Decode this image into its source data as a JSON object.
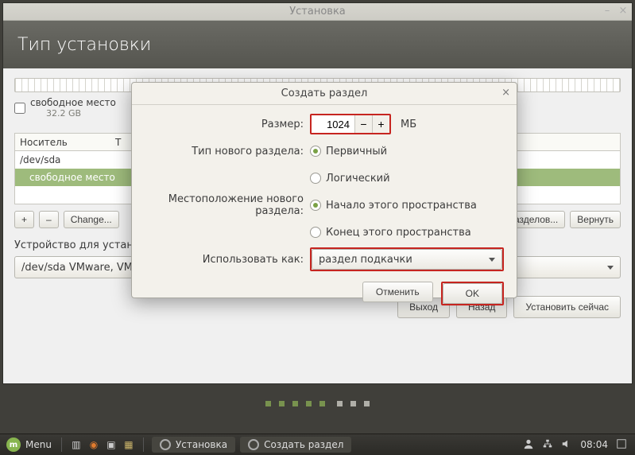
{
  "window": {
    "title": "Установка",
    "minimize": "–",
    "close": "×"
  },
  "header": {
    "title": "Тип установки"
  },
  "free_space": {
    "checkbox_label": "свободное место",
    "size": "32.2 GB"
  },
  "table": {
    "col_device": "Носитель",
    "col_type_initial": "Т",
    "row_device": "/dev/sda",
    "row_free": "свободное место"
  },
  "toolbar": {
    "plus": "+",
    "minus": "–",
    "change": "Change...",
    "new_table_suffix": "азделов...",
    "revert": "Вернуть"
  },
  "device_select": {
    "label": "Устройство для устано",
    "value": "/dev/sda VMware, VMware Virtual S (32.2 GB)"
  },
  "footer": {
    "quit": "Выход",
    "back": "Назад",
    "install": "Установить сейчас"
  },
  "dialog": {
    "title": "Создать раздел",
    "close": "×",
    "size_label": "Размер:",
    "size_value": "1024",
    "size_minus": "−",
    "size_plus": "+",
    "size_unit": "МБ",
    "type_label": "Тип нового раздела:",
    "type_primary": "Первичный",
    "type_logical": "Логический",
    "loc_label": "Местоположение нового раздела:",
    "loc_begin": "Начало этого пространства",
    "loc_end": "Конец этого пространства",
    "use_label": "Использовать как:",
    "use_value": "раздел подкачки",
    "cancel": "Отменить",
    "ok": "OK"
  },
  "taskbar": {
    "menu": "Menu",
    "task1": "Установка",
    "task2": "Создать раздел",
    "time": "08:04"
  }
}
